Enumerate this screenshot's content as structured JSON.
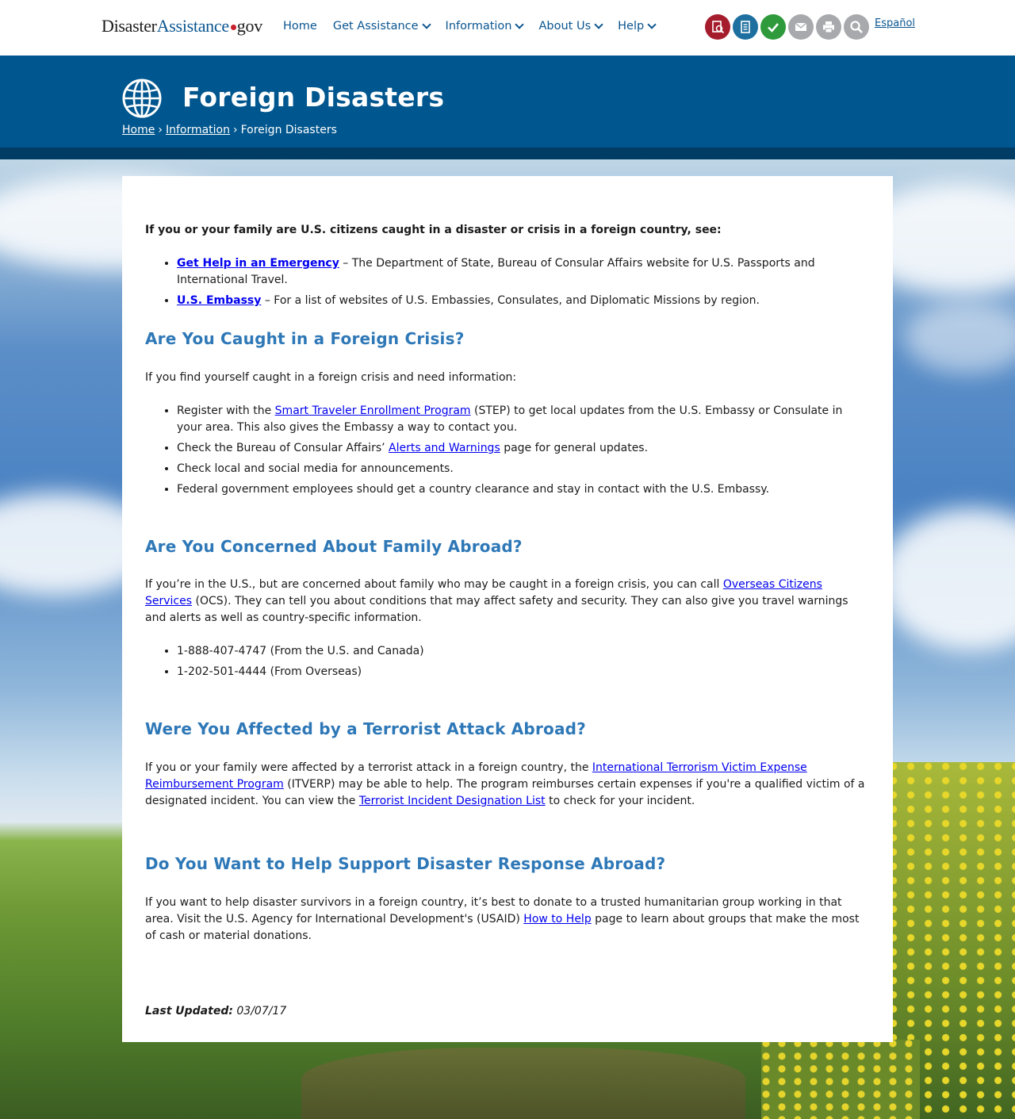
{
  "logo": {
    "part1": "Disaster",
    "part2": "Assistance",
    "part3": "gov"
  },
  "nav": [
    {
      "label": "Home",
      "dropdown": false
    },
    {
      "label": "Get Assistance",
      "dropdown": true
    },
    {
      "label": "Information",
      "dropdown": true
    },
    {
      "label": "About Us",
      "dropdown": true
    },
    {
      "label": "Help",
      "dropdown": true
    }
  ],
  "tools": [
    {
      "icon": "application-lookup-icon",
      "color": "#a51d2d"
    },
    {
      "icon": "checklist-icon",
      "color": "#1d6f9f"
    },
    {
      "icon": "checkmark-icon",
      "color": "#2e9a3c"
    },
    {
      "icon": "email-icon",
      "color": "#a7a9ac"
    },
    {
      "icon": "print-icon",
      "color": "#a7a9ac"
    },
    {
      "icon": "search-icon",
      "color": "#a7a9ac"
    }
  ],
  "espanol": "Español",
  "hero": {
    "title": "Foreign Disasters",
    "breadcrumb": {
      "home": "Home",
      "information": "Information",
      "current": "Foreign Disasters",
      "separator": "›"
    }
  },
  "intro": {
    "lead": "If you or your family are U.S. citizens caught in a disaster or crisis in a foreign country, see:",
    "items": [
      {
        "link": "Get Help in an Emergency",
        "text": " – The Department of State, Bureau of Consular Affairs website for U.S. Passports and International Travel."
      },
      {
        "link": "U.S. Embassy",
        "text": " – For a list of websites of U.S. Embassies, Consulates, and Diplomatic Missions by region."
      }
    ]
  },
  "section1": {
    "heading": "Are You Caught in a Foreign Crisis?",
    "lead": "If you find yourself caught in a foreign crisis and need information:",
    "item1": {
      "pre": "Register with the ",
      "link": "Smart Traveler Enrollment Program",
      "post": " (STEP) to get local updates from the U.S. Embassy or Consulate in your area. This also gives the Embassy a way to contact you."
    },
    "item2": {
      "pre": "Check the Bureau of Consular Affairs’ ",
      "link": "Alerts and Warnings",
      "post": " page for general updates."
    },
    "item3": "Check local and social media for announcements.",
    "item4": "Federal government employees should get a country clearance and stay in contact with the U.S. Embassy."
  },
  "section2": {
    "heading": "Are You Concerned About Family Abroad?",
    "pre": "If you’re in the U.S., but are concerned about family who may be caught in a foreign crisis, you can call ",
    "link": "Overseas Citizens Services",
    "post": " (OCS). They can tell you about conditions that may affect safety and security. They can also give you travel warnings and alerts as well as country-specific information.",
    "phones": [
      "1-888-407-4747 (From the U.S. and Canada)",
      "1-202-501-4444 (From Overseas)"
    ]
  },
  "section3": {
    "heading": "Were You Affected by a Terrorist Attack Abroad?",
    "pre": "If you or your family were affected by a terrorist attack in a foreign country, the ",
    "link1": "International Terrorism Victim Expense Reimbursement Program",
    "mid": " (ITVERP) may be able to help. The program reimburses certain expenses if you're a qualified victim of a designated incident. You can view the ",
    "link2": "Terrorist Incident Designation List",
    "post": " to check for your incident."
  },
  "section4": {
    "heading": "Do You Want to Help Support Disaster Response Abroad?",
    "pre": "If you want to help disaster survivors in a foreign country, it’s best to donate to a trusted humanitarian group working in that area. Visit the U.S. Agency for International Development's (USAID) ",
    "link": "How to Help",
    "post": " page to learn about groups that make the most of cash or material donations."
  },
  "last_updated": {
    "label": "Last Updated:",
    "date": "03/07/17"
  }
}
